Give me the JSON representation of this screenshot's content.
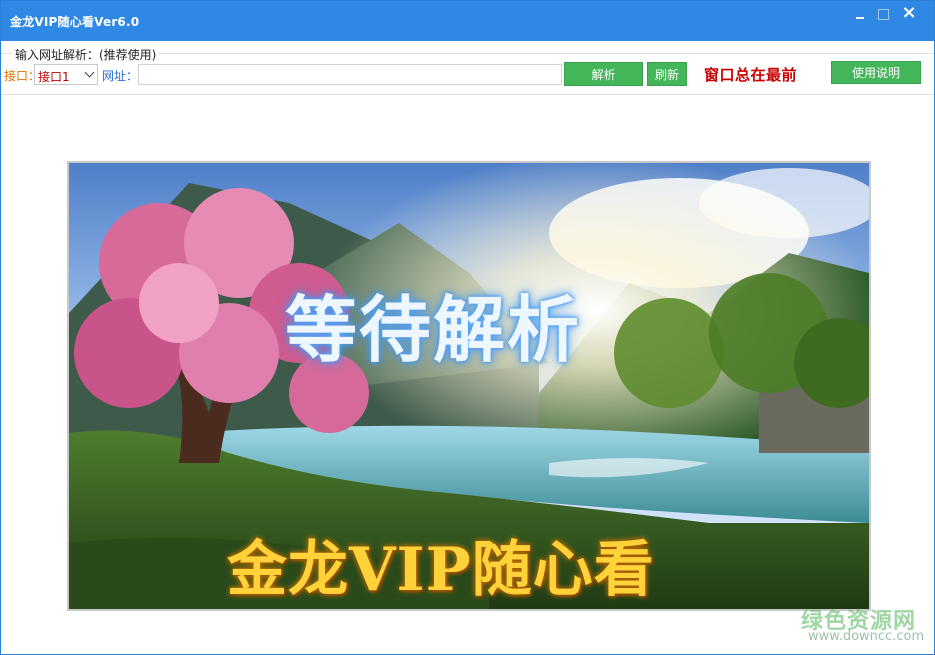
{
  "window": {
    "title": "金龙VIP随心看Ver6.0",
    "controls": {
      "minimize": "minimize",
      "maximize": "maximize",
      "close": "×"
    }
  },
  "group": {
    "title": "输入网址解析：(推荐使用)",
    "interface_label": "接口：",
    "interface_value": "接口1",
    "url_label": "网址：",
    "url_value": "",
    "parse_button": "解析",
    "refresh_button": "刷新",
    "always_on_top": "窗口总在最前",
    "help_button": "使用说明"
  },
  "player": {
    "status_text": "等待解析",
    "brand_text": "金龙VIP随心看"
  },
  "watermark": {
    "main": "绿色资源网",
    "sub": "www.downcc.com"
  },
  "colors": {
    "titlebar": "#2f89e4",
    "button_green": "#43b65a",
    "ontop_red": "#c80000",
    "interface_label": "#e07000",
    "url_label": "#2a6fd6"
  },
  "icons": [
    "minimize-icon",
    "maximize-icon",
    "close-icon",
    "chevron-down-icon"
  ]
}
